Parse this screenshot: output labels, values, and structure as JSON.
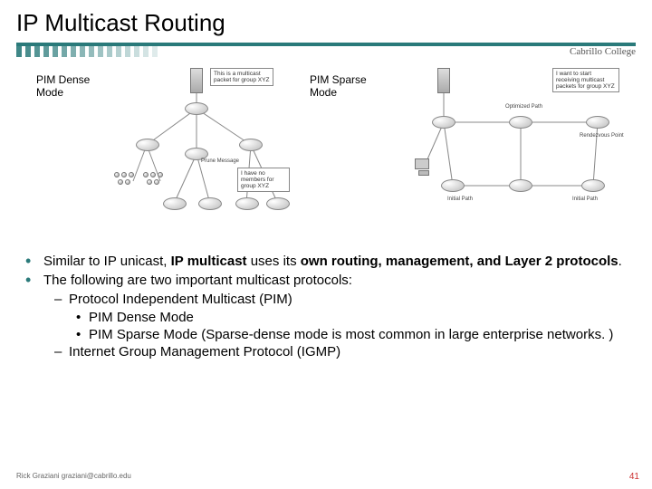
{
  "title": "IP Multicast Routing",
  "college": "Cabrillo College",
  "figures": {
    "left": {
      "label_l1": "PIM Dense",
      "label_l2": "Mode",
      "callout_top": "This is a multicast packet for group XYZ",
      "callout_mid": "Prune Message",
      "callout_bot": "I have no members for group XYZ"
    },
    "right": {
      "label_l1": "PIM Sparse",
      "label_l2": "Mode",
      "callout_top": "I want to start receiving multicast packets for group XYZ",
      "label_opt": "Optimized Path",
      "label_rp": "Rendezvous Point",
      "label_init1": "Initial Path",
      "label_init2": "Initial Path"
    }
  },
  "bullets": {
    "b1a_pre": "Similar to IP unicast, ",
    "b1a_bold": "IP multicast ",
    "b1a_post1": "uses its ",
    "b1a_bold2": "own routing, management, and Layer 2 protocols",
    "b1a_tail": ".",
    "b1b": "The following are two important multicast protocols:",
    "b2a": "Protocol Independent Multicast (PIM)",
    "b3a": "PIM Dense Mode",
    "b3b": "PIM Sparse Mode (Sparse-dense mode is most common in large enterprise networks. )",
    "b2b": "Internet Group Management Protocol (IGMP)"
  },
  "footer": "Rick Graziani  graziani@cabrillo.edu",
  "page": "41"
}
